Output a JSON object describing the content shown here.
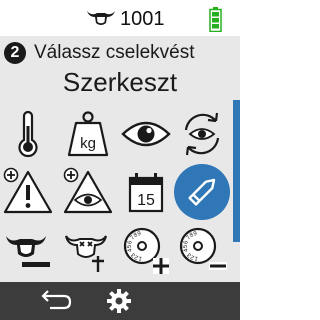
{
  "status": {
    "cow_number": "1001",
    "battery_color": "#27b01e",
    "battery_level": 1.0
  },
  "header": {
    "step": "2",
    "title": "Válassz cselekvést",
    "subtitle": "Szerkeszt"
  },
  "accent_color": "#2f77b7",
  "actions": [
    {
      "name": "thermometer-icon",
      "selected": false
    },
    {
      "name": "weight-kg-icon",
      "label": "kg",
      "selected": false
    },
    {
      "name": "eye-icon",
      "selected": false
    },
    {
      "name": "repeat-observation-icon",
      "selected": false
    },
    {
      "name": "add-warning-icon",
      "selected": false
    },
    {
      "name": "add-observation-icon",
      "selected": false
    },
    {
      "name": "calendar-icon",
      "label": "15",
      "selected": false
    },
    {
      "name": "edit-pencil-icon",
      "selected": true
    },
    {
      "name": "remove-cow-icon",
      "selected": false
    },
    {
      "name": "dead-cow-icon",
      "selected": false
    },
    {
      "name": "add-ear-tag-icon",
      "label": "123 456 789",
      "selected": false
    },
    {
      "name": "remove-ear-tag-icon",
      "label": "123 456 789",
      "selected": false
    }
  ],
  "bottom_bar": {
    "back": "back-arrow-icon",
    "settings": "gear-icon"
  }
}
